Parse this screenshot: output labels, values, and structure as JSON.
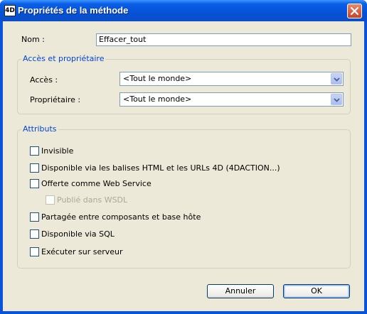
{
  "window": {
    "title": "Propriétés de la méthode",
    "app_icon_text": "4D"
  },
  "form": {
    "name_label": "Nom :",
    "name_value": "Effacer_tout"
  },
  "access_group": {
    "title": "Accès et propriétaire",
    "access_label": "Accès :",
    "access_value": "<Tout le monde>",
    "owner_label": "Propriétaire :",
    "owner_value": "<Tout le monde>"
  },
  "attributes_group": {
    "title": "Attributs",
    "items": [
      {
        "label": "Invisible",
        "checked": false,
        "enabled": true
      },
      {
        "label": "Disponible via les balises HTML et les URLs 4D (4DACTION...)",
        "checked": false,
        "enabled": true
      },
      {
        "label": "Offerte comme Web Service",
        "checked": false,
        "enabled": true
      },
      {
        "label": "Publié dans WSDL",
        "checked": false,
        "enabled": false
      },
      {
        "label": "Partagée entre composants et base hôte",
        "checked": false,
        "enabled": true
      },
      {
        "label": "Disponible via SQL",
        "checked": false,
        "enabled": true
      },
      {
        "label": "Exécuter sur serveur",
        "checked": false,
        "enabled": true
      }
    ]
  },
  "buttons": {
    "cancel": "Annuler",
    "ok": "OK"
  }
}
